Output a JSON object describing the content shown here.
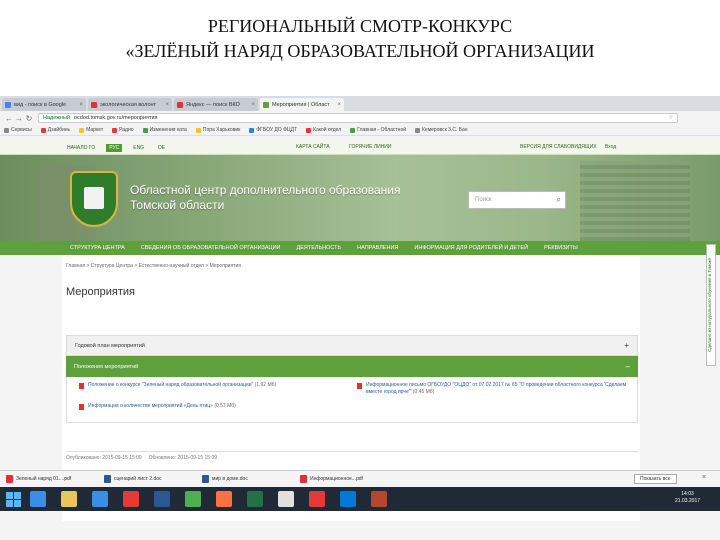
{
  "slide": {
    "title_line1": "РЕГИОНАЛЬНЫЙ СМОТР-КОНКУРС",
    "title_line2": "«ЗЕЛЁНЫЙ НАРЯД ОБРАЗОВАТЕЛЬНОЙ ОРГАНИЗАЦИИ"
  },
  "browser": {
    "tabs": [
      {
        "label": "вид - поиск в Google",
        "color": "#4285f4",
        "active": false
      },
      {
        "label": "экологическая волонт",
        "color": "#e03333",
        "active": false
      },
      {
        "label": "Яндекс — поиск ВКО",
        "color": "#e03333",
        "active": false
      },
      {
        "label": "Мероприятия | Област",
        "color": "#5ea13c",
        "active": true
      }
    ],
    "url": "ocdod.tomsk.gov.ru/mероприятия",
    "secure_label": "Надежный",
    "bookmarks": [
      "Сервисы",
      "Дзайбинь",
      "Маркет",
      "Радио",
      "Изменения ката",
      "Пора Харьковик",
      "ФГБОУ ДО ФЦДТ",
      "Какой отдел",
      "Главная - Областной",
      "Кемеровск 3.С. Бан"
    ]
  },
  "site": {
    "topbar": {
      "lang_items": [
        "НАЧАЛО ГО",
        "РУС",
        "ENG",
        "DE"
      ],
      "lang_current": "РУС",
      "links": [
        "КАРТА САЙТА",
        "ГОРЯЧИЕ ЛИНИИ"
      ],
      "accessibility": "ВЕРСИЯ ДЛЯ СЛАБОВИДЯЩИХ",
      "login": "Вход"
    },
    "name_line1": "Областной центр дополнительного образования",
    "name_line2": "Томской области",
    "search_placeholder": "Поиск",
    "nav": [
      "СТРУКТУРА ЦЕНТРА",
      "СВЕДЕНИЯ ОБ ОБРАЗОВАТЕЛЬНОЙ ОРГАНИЗАЦИИ",
      "ДЕЯТЕЛЬНОСТЬ",
      "НАПРАВЛЕНИЯ",
      "ИНФОРМАЦИЯ ДЛЯ РОДИТЕЛЕЙ И ДЕТЕЙ",
      "РЕКВИЗИТЫ"
    ],
    "breadcrumb": "Главная > Структура Центра > Естественно-научный отдел > Мероприятия",
    "page_title": "Мероприятия",
    "accordion_1": "Годовой план мероприятий",
    "accordion_2": "Положения мероприятий",
    "docs": [
      {
        "text": "Положение о конкурсе \"Зеленый наряд образовательной организации\"",
        "size": "(1.92 Мб)"
      },
      {
        "text": "Информационное письмо ОГБОУДО \"ОЦДО\" от 07.02.2017 № 65 \"О проведении областного конкурса 'Сделаем вместе город ярче'\"",
        "size": "(0.45 Мб)"
      },
      {
        "text": "Информация о количестве мероприятий «День птиц»",
        "size": "(0.57 Мб)"
      }
    ],
    "published_label": "Опубликовано:",
    "published_value": "2015-09-15 15:09",
    "updated_label": "Обновлено:",
    "updated_value": "2015-09-15 15:09",
    "side_badge": "Сделано из натурального обучения в Томске"
  },
  "downloads": {
    "items": [
      {
        "name": "Зеленый наряд 01....pdf",
        "color": "#d33"
      },
      {
        "name": "сценарий лист 2.doc",
        "color": "#2b5797"
      },
      {
        "name": "мир в доме.doc",
        "color": "#2b5797"
      },
      {
        "name": "Информационное...pdf",
        "color": "#d33"
      }
    ],
    "show_all": "Показать все",
    "close": "×"
  },
  "taskbar": {
    "icons": [
      "#3a8ee6",
      "#e8c65b",
      "#3a8ee6",
      "#e53935",
      "#2b5797",
      "#4caf50",
      "#ff7043",
      "#217346",
      "#e0e0e0",
      "#e53935",
      "#0078d7",
      "#b7472a"
    ],
    "time": "14:03",
    "date": "21.03.2017"
  }
}
